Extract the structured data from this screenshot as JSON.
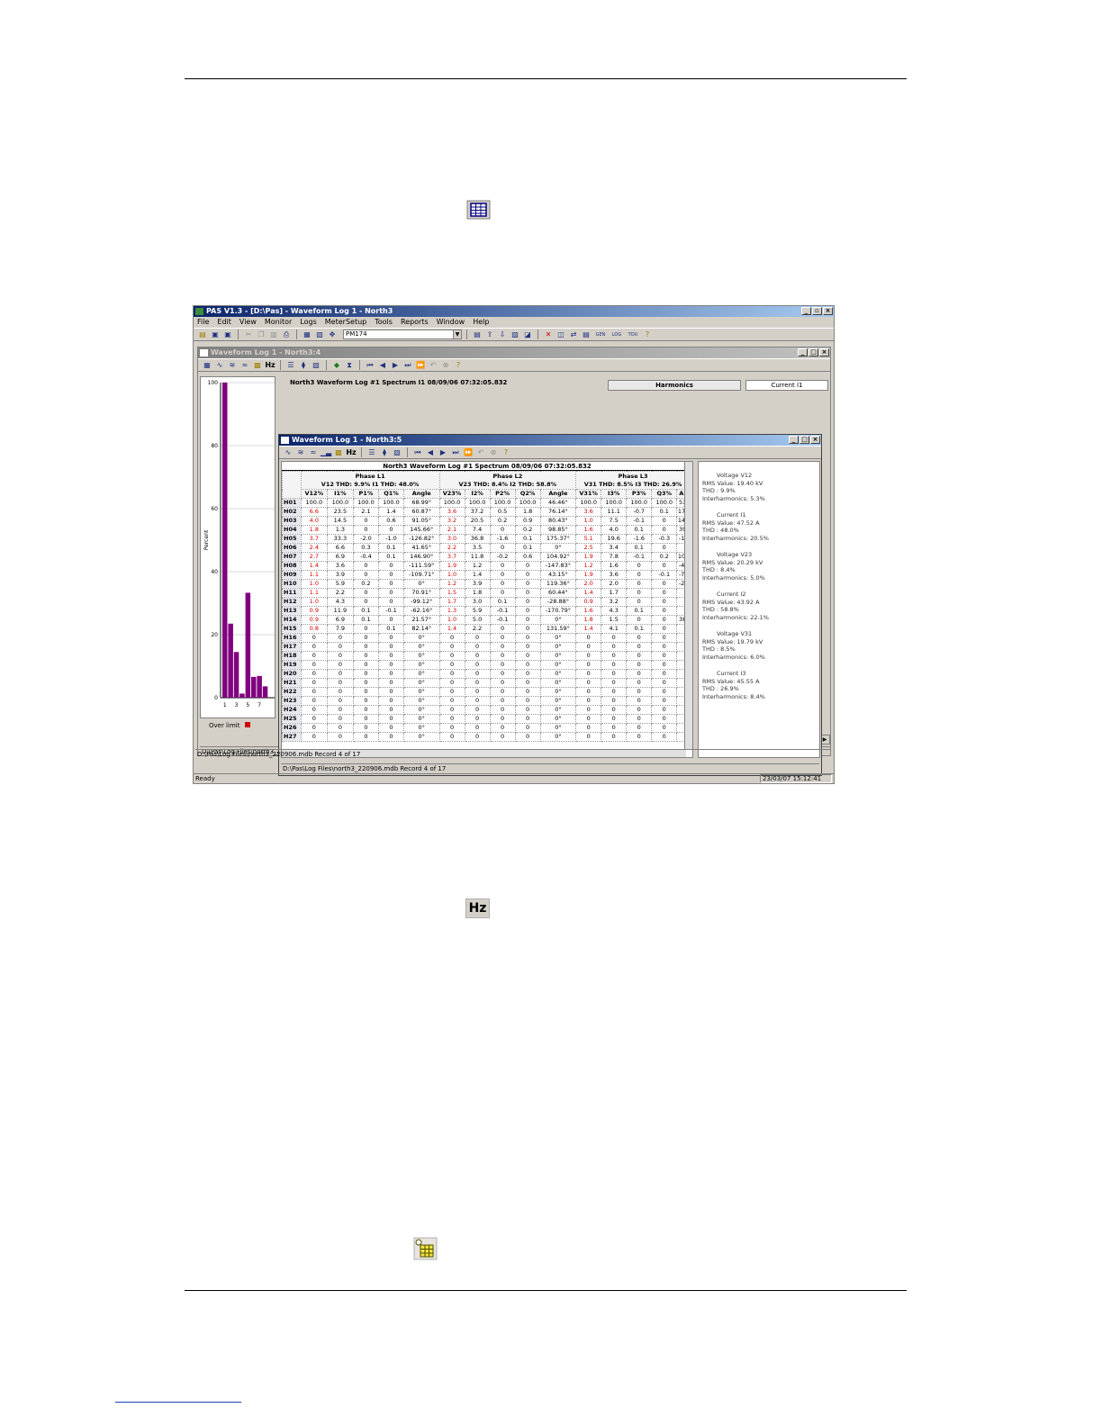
{
  "app": {
    "title": "PAS V1.3 - [D:\\Pas] - Waveform Log 1 - North3",
    "menu": [
      "File",
      "Edit",
      "View",
      "Monitor",
      "Logs",
      "MeterSetup",
      "Tools",
      "Reports",
      "Window",
      "Help"
    ],
    "device": "PM174",
    "status": "Ready",
    "clock": "23/03/07 15:12:41",
    "tb_gen": "GEN",
    "tb_log": "LOG",
    "tb_tou": "TOU"
  },
  "page_icons": {
    "table_icon": "table-view-icon",
    "hz_icon": "Hz",
    "options_icon": "channels-icon"
  },
  "win_a": {
    "title": "Waveform Log 1 - North3:4",
    "pane_title": "North3 Waveform Log #1  Spectrum I1  08/09/06  07:32:05.832",
    "harmonics": "Harmonics",
    "current": "Current I1",
    "ylabel": "Percent",
    "over_limit": "Over limit",
    "path": "D:\\Pas\\Log Files\\north3_220906.mdb  Record 4 of 17",
    "hz": "Hz"
  },
  "win_b": {
    "title": "Waveform Log 1 - North3:5",
    "grid_title": "North3  Waveform Log #1   Spectrum  08/09/06  07:32:05.832",
    "path": "D:\\Pas\\Log Files\\north3_220906.mdb  Record 4 of 17",
    "hz": "Hz",
    "phases": [
      {
        "name": "Phase L1",
        "thd": "V12 THD: 9.9% I1 THD: 48.0%"
      },
      {
        "name": "Phase L2",
        "thd": "V23 THD: 8.4% I2 THD: 58.8%"
      },
      {
        "name": "Phase L3",
        "thd": "V31 THD: 8.5% I3 THD: 26.9%"
      }
    ],
    "columns": [
      "V12%",
      "I1%",
      "P1%",
      "Q1%",
      "Angle",
      "V23%",
      "I2%",
      "P2%",
      "Q2%",
      "Angle",
      "V31%",
      "I3%",
      "P3%",
      "Q3%",
      "An"
    ],
    "rows": [
      [
        "H01",
        "100.0",
        "100.0",
        "100.0",
        "100.0",
        "68.99°",
        "100.0",
        "100.0",
        "100.0",
        "100.0",
        "46.46°",
        "100.0",
        "100.0",
        "100.0",
        "100.0",
        "53."
      ],
      [
        "H02",
        "6.6",
        "23.5",
        "2.1",
        "1.4",
        "60.87°",
        "3.6",
        "37.2",
        "0.5",
        "1.8",
        "76.14°",
        "3.6",
        "11.1",
        "-0.7",
        "0.1",
        "170"
      ],
      [
        "H03",
        "4.0",
        "14.5",
        "0",
        "0.6",
        "91.05°",
        "3.2",
        "20.5",
        "0.2",
        "0.9",
        "80.43°",
        "1.0",
        "7.5",
        "-0.1",
        "0",
        "149"
      ],
      [
        "H04",
        "1.8",
        "1.3",
        "0",
        "0",
        "145.66°",
        "2.1",
        "7.4",
        "0",
        "0.2",
        "98.85°",
        "1.6",
        "4.0",
        "0.1",
        "0",
        "39."
      ],
      [
        "H05",
        "3.7",
        "33.3",
        "-2.0",
        "-1.0",
        "-126.82°",
        "3.0",
        "36.8",
        "-1.6",
        "0.1",
        "175.37°",
        "5.1",
        "19.6",
        "-1.6",
        "-0.3",
        "-16"
      ],
      [
        "H06",
        "2.4",
        "6.6",
        "0.3",
        "0.1",
        "41.65°",
        "2.2",
        "3.5",
        "0",
        "0.1",
        "0°",
        "2.5",
        "3.4",
        "0.1",
        "0",
        ""
      ],
      [
        "H07",
        "2.7",
        "6.9",
        "-0.4",
        "0.1",
        "146.90°",
        "3.7",
        "11.8",
        "-0.2",
        "0.6",
        "104.92°",
        "1.9",
        "7.8",
        "-0.1",
        "0.2",
        "105"
      ],
      [
        "H08",
        "1.4",
        "3.6",
        "0",
        "0",
        "-111.59°",
        "1.9",
        "1.2",
        "0",
        "0",
        "-147.83°",
        "1.2",
        "1.6",
        "0",
        "0",
        "-47"
      ],
      [
        "H09",
        "1.1",
        "3.9",
        "0",
        "0",
        "-109.71°",
        "1.0",
        "1.4",
        "0",
        "0",
        "43.15°",
        "1.9",
        "3.6",
        "0",
        "-0.1",
        "-77"
      ],
      [
        "H10",
        "1.0",
        "5.9",
        "0.2",
        "0",
        "0°",
        "1.2",
        "3.9",
        "0",
        "0",
        "119.36°",
        "2.0",
        "2.0",
        "0",
        "0",
        "-26"
      ],
      [
        "H11",
        "1.1",
        "2.2",
        "0",
        "0",
        "70.91°",
        "1.5",
        "1.8",
        "0",
        "0",
        "60.44°",
        "1.4",
        "1.7",
        "0",
        "0",
        ""
      ],
      [
        "H12",
        "1.0",
        "4.3",
        "0",
        "0",
        "-99.12°",
        "1.7",
        "3.0",
        "0.1",
        "0",
        "-28.88°",
        "0.9",
        "3.2",
        "0",
        "0",
        ""
      ],
      [
        "H13",
        "0.9",
        "11.9",
        "0.1",
        "-0.1",
        "-62.16°",
        "1.3",
        "5.9",
        "-0.1",
        "0",
        "-170.79°",
        "1.6",
        "4.3",
        "0.1",
        "0",
        ""
      ],
      [
        "H14",
        "0.9",
        "6.9",
        "0.1",
        "0",
        "21.57°",
        "1.0",
        "5.0",
        "-0.1",
        "0",
        "0°",
        "1.8",
        "1.5",
        "0",
        "0",
        "38."
      ],
      [
        "H15",
        "0.8",
        "7.9",
        "0",
        "0.1",
        "82.14°",
        "1.4",
        "2.2",
        "0",
        "0",
        "131.59°",
        "1.4",
        "4.1",
        "0.1",
        "0",
        ""
      ],
      [
        "H16",
        "0",
        "0",
        "0",
        "0",
        "0°",
        "0",
        "0",
        "0",
        "0",
        "0°",
        "0",
        "0",
        "0",
        "0",
        ""
      ],
      [
        "H17",
        "0",
        "0",
        "0",
        "0",
        "0°",
        "0",
        "0",
        "0",
        "0",
        "0°",
        "0",
        "0",
        "0",
        "0",
        ""
      ],
      [
        "H18",
        "0",
        "0",
        "0",
        "0",
        "0°",
        "0",
        "0",
        "0",
        "0",
        "0°",
        "0",
        "0",
        "0",
        "0",
        ""
      ],
      [
        "H19",
        "0",
        "0",
        "0",
        "0",
        "0°",
        "0",
        "0",
        "0",
        "0",
        "0°",
        "0",
        "0",
        "0",
        "0",
        ""
      ],
      [
        "H20",
        "0",
        "0",
        "0",
        "0",
        "0°",
        "0",
        "0",
        "0",
        "0",
        "0°",
        "0",
        "0",
        "0",
        "0",
        ""
      ],
      [
        "H21",
        "0",
        "0",
        "0",
        "0",
        "0°",
        "0",
        "0",
        "0",
        "0",
        "0°",
        "0",
        "0",
        "0",
        "0",
        ""
      ],
      [
        "H22",
        "0",
        "0",
        "0",
        "0",
        "0°",
        "0",
        "0",
        "0",
        "0",
        "0°",
        "0",
        "0",
        "0",
        "0",
        ""
      ],
      [
        "H23",
        "0",
        "0",
        "0",
        "0",
        "0°",
        "0",
        "0",
        "0",
        "0",
        "0°",
        "0",
        "0",
        "0",
        "0",
        ""
      ],
      [
        "H24",
        "0",
        "0",
        "0",
        "0",
        "0°",
        "0",
        "0",
        "0",
        "0",
        "0°",
        "0",
        "0",
        "0",
        "0",
        ""
      ],
      [
        "H25",
        "0",
        "0",
        "0",
        "0",
        "0°",
        "0",
        "0",
        "0",
        "0",
        "0°",
        "0",
        "0",
        "0",
        "0",
        ""
      ],
      [
        "H26",
        "0",
        "0",
        "0",
        "0",
        "0°",
        "0",
        "0",
        "0",
        "0",
        "0°",
        "0",
        "0",
        "0",
        "0",
        ""
      ],
      [
        "H27",
        "0",
        "0",
        "0",
        "0",
        "0°",
        "0",
        "0",
        "0",
        "0",
        "0°",
        "0",
        "0",
        "0",
        "0",
        ""
      ]
    ],
    "red_cols": [
      1,
      6,
      11
    ],
    "red_rows_end": 15,
    "summary": [
      {
        "title": "Voltage V12",
        "lines": [
          "RMS Value: 19.40 kV",
          "THD : 9.9%",
          "Interharmonics:  5.3%"
        ]
      },
      {
        "title": "Current I1",
        "lines": [
          "RMS Value: 47.52 A",
          "THD : 48.0%",
          "Interharmonics:  20.5%"
        ]
      },
      {
        "title": "Voltage V23",
        "lines": [
          "RMS Value: 20.29 kV",
          "THD : 8.4%",
          "Interharmonics:  5.0%"
        ]
      },
      {
        "title": "Current I2",
        "lines": [
          "RMS Value: 43.92 A",
          "THD : 58.8%",
          "Interharmonics:  22.1%"
        ]
      },
      {
        "title": "Voltage V31",
        "lines": [
          "RMS Value: 19.79 kV",
          "THD : 8.5%",
          "Interharmonics:  6.0%"
        ]
      },
      {
        "title": "Current I3",
        "lines": [
          "RMS Value: 45.55 A",
          "THD : 26.9%",
          "Interharmonics:  8.4%"
        ]
      }
    ]
  },
  "chart_data": {
    "type": "bar",
    "title": "",
    "xlabel": "",
    "ylabel": "Percent",
    "ylim": [
      0,
      100
    ],
    "yticks": [
      0,
      20,
      40,
      60,
      80,
      100
    ],
    "xticks": [
      "1",
      "3",
      "5",
      "7"
    ],
    "categories": [
      "1",
      "2",
      "3",
      "4",
      "5",
      "6",
      "7",
      "8"
    ],
    "values": [
      100,
      23.5,
      14.5,
      1.3,
      33.3,
      6.6,
      6.9,
      3.6
    ],
    "color": "#800080",
    "grid": true
  }
}
